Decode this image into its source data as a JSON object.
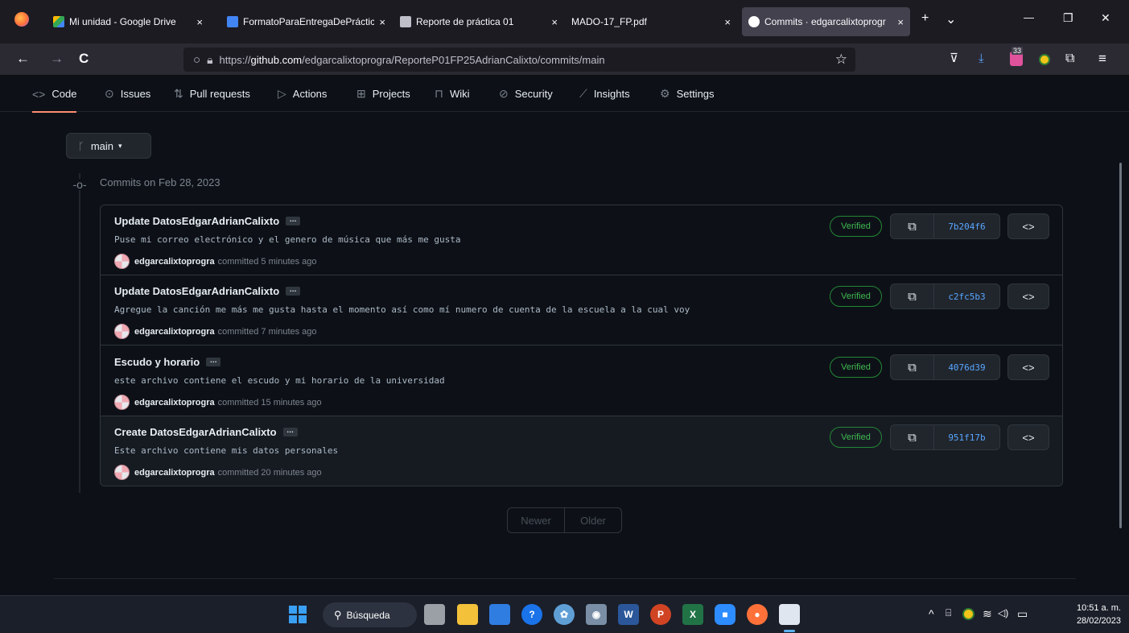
{
  "browser": {
    "tabs": [
      {
        "title": "Mi unidad - Google Drive",
        "close": "×",
        "favicon_color": "#34a853"
      },
      {
        "title": "FormatoParaEntregaDePráctic",
        "close": "×",
        "favicon_color": "#4285f4"
      },
      {
        "title": "Reporte de práctica 01",
        "close": "×",
        "favicon_color": "#bfbfc9"
      },
      {
        "title": "MADO-17_FP.pdf",
        "close": "×",
        "favicon_color": "#1c1b22"
      },
      {
        "title": "Commits · edgarcalixtoprogr",
        "close": "×",
        "favicon_color": "#ffffff"
      }
    ],
    "new_tab": "+",
    "tab_list": "⌄",
    "window": {
      "minimize": "—",
      "restore": "❐",
      "close": "✕"
    },
    "nav": {
      "back": "←",
      "forward": "→",
      "reload": "C"
    },
    "url_prefix": "https://",
    "url_host": "github.com",
    "url_path": "/edgarcalixtoprogra/ReporteP01FP25AdrianCalixto/commits/main",
    "toolbar": {
      "pocket": "⊽",
      "download": "⤓",
      "badge": "33",
      "menu": "≡"
    }
  },
  "repo_nav": [
    {
      "label": "Code",
      "icon": "<>",
      "icon_name": "code-icon"
    },
    {
      "label": "Issues",
      "icon": "⊙",
      "icon_name": "issue-icon"
    },
    {
      "label": "Pull requests",
      "icon": "⇅",
      "icon_name": "pull-request-icon"
    },
    {
      "label": "Actions",
      "icon": "▷",
      "icon_name": "play-icon"
    },
    {
      "label": "Projects",
      "icon": "⊞",
      "icon_name": "table-icon"
    },
    {
      "label": "Wiki",
      "icon": "⊓",
      "icon_name": "book-icon"
    },
    {
      "label": "Security",
      "icon": "⊘",
      "icon_name": "shield-icon"
    },
    {
      "label": "Insights",
      "icon": "⟋",
      "icon_name": "graph-icon"
    },
    {
      "label": "Settings",
      "icon": "⚙",
      "icon_name": "gear-icon"
    }
  ],
  "branch": {
    "name": "main",
    "icon": "ᚴ",
    "caret": "▾"
  },
  "group_title": "Commits on Feb 28, 2023",
  "commits": [
    {
      "title": "Update DatosEdgarAdrianCalixto",
      "message": "Puse mi correo electrónico y el genero de música que más me gusta",
      "author": "edgarcalixtoprogra",
      "time": "committed 5 minutes ago",
      "verified": "Verified",
      "sha": "7b204f6"
    },
    {
      "title": "Update DatosEdgarAdrianCalixto",
      "message": "Agregue la canción me más me gusta hasta el momento así como mí numero de cuenta de la escuela a la cual voy",
      "author": "edgarcalixtoprogra",
      "time": "committed 7 minutes ago",
      "verified": "Verified",
      "sha": "c2fc5b3"
    },
    {
      "title": "Escudo y horario",
      "message": "este archivo contiene el escudo y mi horario de la universidad",
      "author": "edgarcalixtoprogra",
      "time": "committed 15 minutes ago",
      "verified": "Verified",
      "sha": "4076d39"
    },
    {
      "title": "Create DatosEdgarAdrianCalixto",
      "message": "Este archivo contiene mis datos personales",
      "author": "edgarcalixtoprogra",
      "time": "committed 20 minutes ago",
      "verified": "Verified",
      "sha": "951f17b"
    }
  ],
  "commit_actions": {
    "ellipsis": "…",
    "copy_icon": "⧉",
    "browse_icon": "<>"
  },
  "pagination": {
    "newer": "Newer",
    "older": "Older"
  },
  "taskbar": {
    "search_label": "Búsqueda",
    "search_icon": "⚲",
    "apps": [
      {
        "name": "start",
        "color": "#3aa0f3",
        "glyph": ""
      },
      {
        "name": "task-view",
        "color": "#9aa0a6",
        "glyph": ""
      },
      {
        "name": "file-explorer",
        "color": "#f3c13a",
        "glyph": ""
      },
      {
        "name": "store",
        "color": "#2f7de1",
        "glyph": ""
      },
      {
        "name": "help",
        "color": "#1a73e8",
        "glyph": "?"
      },
      {
        "name": "settings",
        "color": "#5f9fd6",
        "glyph": "✿"
      },
      {
        "name": "camera",
        "color": "#7a8fa6",
        "glyph": "◉"
      },
      {
        "name": "word",
        "color": "#2b579a",
        "glyph": "W"
      },
      {
        "name": "powerpoint",
        "color": "#d04423",
        "glyph": "P"
      },
      {
        "name": "excel",
        "color": "#217346",
        "glyph": "X"
      },
      {
        "name": "zoom",
        "color": "#2d8cff",
        "glyph": "■"
      },
      {
        "name": "firefox",
        "color": "#ff7139",
        "glyph": "●"
      },
      {
        "name": "snipping",
        "color": "#e0e6f0",
        "glyph": ""
      }
    ],
    "tray": {
      "chevron": "^",
      "wifi": "≋",
      "volume": "◁)",
      "battery": "▭"
    },
    "time": "10:51 a. m.",
    "date": "28/02/2023"
  }
}
